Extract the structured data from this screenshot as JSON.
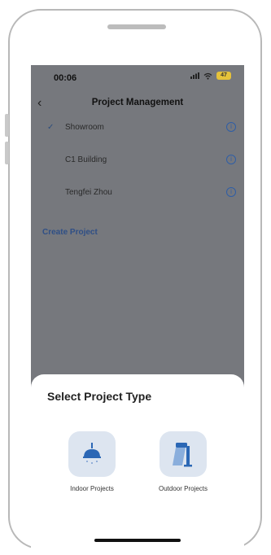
{
  "status_bar": {
    "time": "00:06",
    "battery": "47"
  },
  "nav": {
    "back_icon": "chevron-left-icon",
    "title": "Project Management"
  },
  "projects": [
    {
      "name": "Showroom",
      "selected": true
    },
    {
      "name": "C1 Building",
      "selected": false
    },
    {
      "name": "Tengfei Zhou",
      "selected": false
    }
  ],
  "create_project_label": "Create Project",
  "sheet": {
    "title": "Select Project Type",
    "options": [
      {
        "label": "Indoor Projects",
        "icon": "ceiling-lamp-icon"
      },
      {
        "label": "Outdoor Projects",
        "icon": "street-lamp-icon"
      }
    ]
  },
  "colors": {
    "overlay": "#76787d",
    "accent": "#2f5ea6",
    "tile": "#dde5f0",
    "battery": "#e5c23a"
  }
}
